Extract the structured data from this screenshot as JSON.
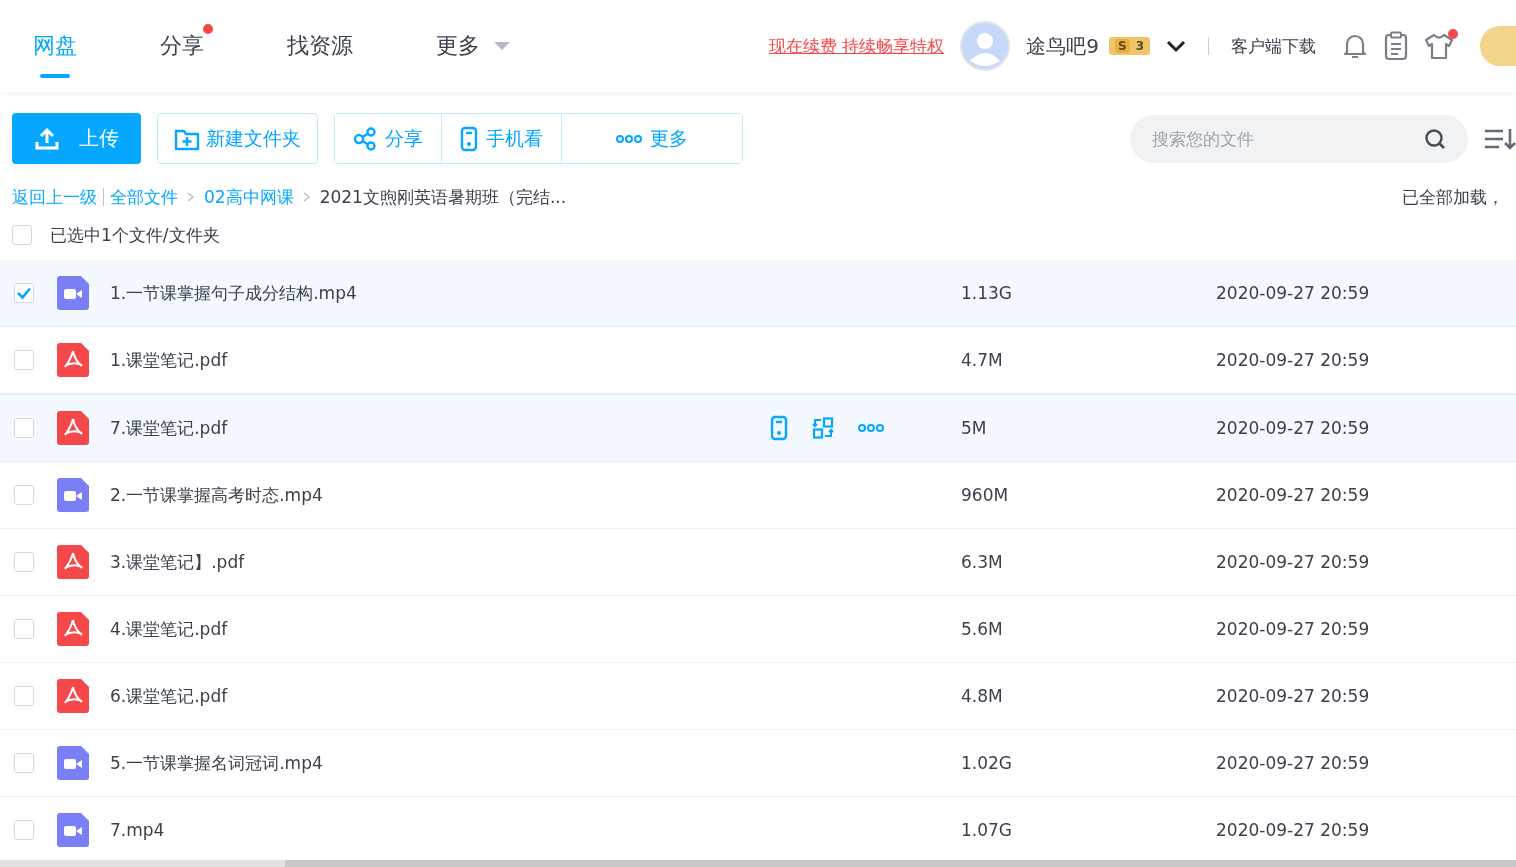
{
  "nav": {
    "tabs": [
      {
        "label": "网盘",
        "selected": true,
        "dot": false,
        "dropdown": false
      },
      {
        "label": "分享",
        "selected": false,
        "dot": true,
        "dropdown": false
      },
      {
        "label": "找资源",
        "selected": false,
        "dot": false,
        "dropdown": false
      },
      {
        "label": "更多",
        "selected": false,
        "dot": false,
        "dropdown": true
      }
    ],
    "promo_link": "现在续费 持续畅享特权",
    "username": "途鸟吧9",
    "level_badge": {
      "s": "S",
      "level": "3"
    },
    "client_download": "客户端下载",
    "shirt_dot": true
  },
  "toolbar": {
    "upload": "上传",
    "new_folder": "新建文件夹",
    "share": "分享",
    "mobile": "手机看",
    "more": "更多",
    "search": {
      "placeholder": "搜索您的文件"
    }
  },
  "breadcrumb": {
    "back": "返回上一级",
    "items": [
      "全部文件",
      "02高中网课"
    ],
    "current": "2021文煦刚英语暑期班（完结...",
    "status": "已全部加载，"
  },
  "selection": {
    "label": "已选中1个文件/文件夹",
    "checked": false
  },
  "files": [
    {
      "name": "1.一节课掌握句子成分结构.mp4",
      "kind": "video",
      "size": "1.13G",
      "date": "2020-09-27 20:59",
      "checked": true,
      "hovered": false
    },
    {
      "name": "1.课堂笔记.pdf",
      "kind": "pdf",
      "size": "4.7M",
      "date": "2020-09-27 20:59",
      "checked": false,
      "hovered": false
    },
    {
      "name": "7.课堂笔记.pdf",
      "kind": "pdf",
      "size": "5M",
      "date": "2020-09-27 20:59",
      "checked": false,
      "hovered": true
    },
    {
      "name": "2.一节课掌握高考时态.mp4",
      "kind": "video",
      "size": "960M",
      "date": "2020-09-27 20:59",
      "checked": false,
      "hovered": false
    },
    {
      "name": "3.课堂笔记】.pdf",
      "kind": "pdf",
      "size": "6.3M",
      "date": "2020-09-27 20:59",
      "checked": false,
      "hovered": false
    },
    {
      "name": "4.课堂笔记.pdf",
      "kind": "pdf",
      "size": "5.6M",
      "date": "2020-09-27 20:59",
      "checked": false,
      "hovered": false
    },
    {
      "name": "6.课堂笔记.pdf",
      "kind": "pdf",
      "size": "4.8M",
      "date": "2020-09-27 20:59",
      "checked": false,
      "hovered": false
    },
    {
      "name": "5.一节课掌握名词冠词.mp4",
      "kind": "video",
      "size": "1.02G",
      "date": "2020-09-27 20:59",
      "checked": false,
      "hovered": false
    },
    {
      "name": "7.mp4",
      "kind": "video",
      "size": "1.07G",
      "date": "2020-09-27 20:59",
      "checked": false,
      "hovered": false
    }
  ]
}
